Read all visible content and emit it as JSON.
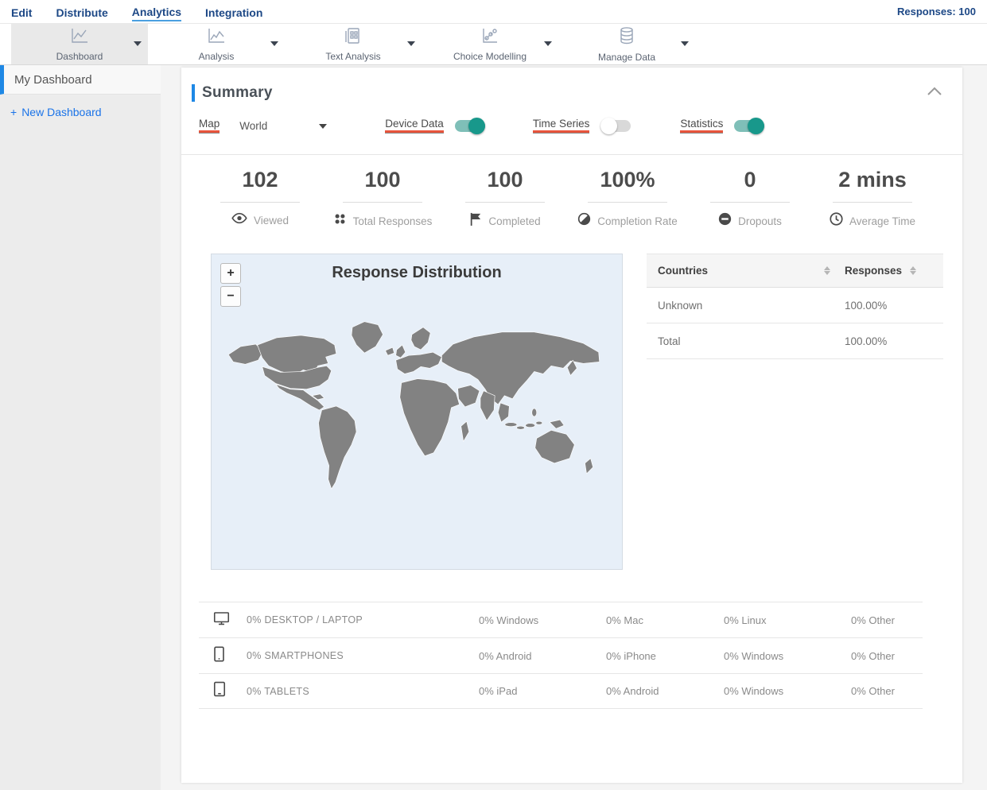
{
  "topnav": {
    "items": [
      "Edit",
      "Distribute",
      "Analytics",
      "Integration"
    ],
    "active": "Analytics",
    "responses": "Responses: 100"
  },
  "toolbar": {
    "tabs": [
      {
        "label": "Dashboard",
        "active": true
      },
      {
        "label": "Analysis",
        "active": false
      },
      {
        "label": "Text Analysis",
        "active": false
      },
      {
        "label": "Choice Modelling",
        "active": false
      },
      {
        "label": "Manage Data",
        "active": false
      }
    ]
  },
  "sidebar": {
    "active_item": "My Dashboard",
    "new_dashboard_plus": "+",
    "new_dashboard": "New Dashboard"
  },
  "summary": {
    "title": "Summary",
    "controls": {
      "map_label": "Map",
      "map_value": "World",
      "device_data_label": "Device Data",
      "device_data_on": true,
      "time_series_label": "Time Series",
      "time_series_on": false,
      "statistics_label": "Statistics",
      "statistics_on": true
    },
    "stats": [
      {
        "value": "102",
        "label": "Viewed",
        "icon": "eye-icon"
      },
      {
        "value": "100",
        "label": "Total Responses",
        "icon": "dots-grid-icon"
      },
      {
        "value": "100",
        "label": "Completed",
        "icon": "flag-icon"
      },
      {
        "value": "100%",
        "label": "Completion Rate",
        "icon": "half-circle-icon"
      },
      {
        "value": "0",
        "label": "Dropouts",
        "icon": "minus-circle-icon"
      },
      {
        "value": "2 mins",
        "label": "Average Time",
        "icon": "clock-icon"
      }
    ],
    "map": {
      "title": "Response Distribution",
      "zoom_in": "+",
      "zoom_out": "−"
    },
    "countries_table": {
      "col_country": "Countries",
      "col_responses": "Responses",
      "rows": [
        {
          "country": "Unknown",
          "responses": "100.00%"
        },
        {
          "country": "Total",
          "responses": "100.00%"
        }
      ]
    },
    "devices": {
      "rows": [
        {
          "icon": "desktop-icon",
          "label": "0% DESKTOP / LAPTOP",
          "c1": "0% Windows",
          "c2": "0% Mac",
          "c3": "0% Linux",
          "c4": "0% Other"
        },
        {
          "icon": "smartphone-icon",
          "label": "0% SMARTPHONES",
          "c1": "0% Android",
          "c2": "0% iPhone",
          "c3": "0% Windows",
          "c4": "0% Other"
        },
        {
          "icon": "tablet-icon",
          "label": "0% TABLETS",
          "c1": "0% iPad",
          "c2": "0% Android",
          "c3": "0% Windows",
          "c4": "0% Other"
        }
      ]
    }
  },
  "colors": {
    "nav_blue": "#1d4886",
    "accent_blue": "#1e88e5",
    "underline_red": "#e8543c",
    "toggle_on_track": "#7fbfb8",
    "toggle_on_knob": "#18988b",
    "map_ocean": "#e7eff8",
    "map_land": "#828282"
  }
}
